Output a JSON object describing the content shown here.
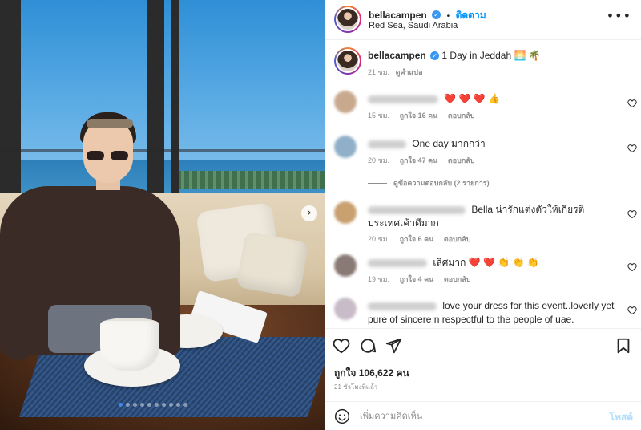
{
  "post": {
    "photo": {
      "alt_icon": "carousel-next-icon",
      "carousel_arrow_glyph": "›",
      "slide_count": 10,
      "active_slide": 1
    },
    "header": {
      "username": "bellacampen",
      "separator": "•",
      "follow_label": "ติดตาม",
      "location": "Red Sea, Saudi Arabia",
      "more_glyph": "•••"
    },
    "caption": {
      "username": "bellacampen",
      "text": "1 Day in Jeddah 🌅 🌴",
      "time": "21 ชม.",
      "translate_label": "ดูคำแปล"
    },
    "comments": [
      {
        "name_hidden": true,
        "text": "❤️ ❤️ ❤️ 👍",
        "time": "15 ชม.",
        "likes": "ถูกใจ 16 คน",
        "reply": "ตอบกลับ",
        "avatar_color": "#c9a98e"
      },
      {
        "name_hidden": true,
        "text": "One day มากกว่า",
        "time": "20 ชม.",
        "likes": "ถูกใจ 47 คน",
        "reply": "ตอบกลับ",
        "avatar_color": "#8fb0c8",
        "view_replies": "ดูข้อความตอบกลับ (2 รายการ)"
      },
      {
        "name_hidden": true,
        "text": "Bella น่ารักแต่งตัวให้เกียรติประเทศเค้าดีมาก",
        "time": "20 ชม.",
        "likes": "ถูกใจ 6 คน",
        "reply": "ตอบกลับ",
        "avatar_color": "#c9a070"
      },
      {
        "name_hidden": true,
        "text": "เลิศมาก ❤️ ❤️ 👏 👏 👏",
        "time": "19 ชม.",
        "likes": "ถูกใจ 4 คน",
        "reply": "ตอบกลับ",
        "avatar_color": "#8a7a76"
      },
      {
        "name_hidden": true,
        "text": "love your dress for this event..loverly yet pure of sincere n respectful to the people of uae.",
        "avatar_color": "#c8bcc8"
      }
    ],
    "actions": {
      "likes": "ถูกใจ 106,622 คน",
      "posted": "21 ชั่วโมงที่แล้ว"
    },
    "add_comment": {
      "placeholder": "เพิ่มความคิดเห็น",
      "post_label": "โพสต์"
    },
    "colors": {
      "link_blue": "#0095f6",
      "post_disabled": "#b2dffc",
      "muted": "#8e8e8e",
      "like_red": "#ed4956"
    }
  }
}
